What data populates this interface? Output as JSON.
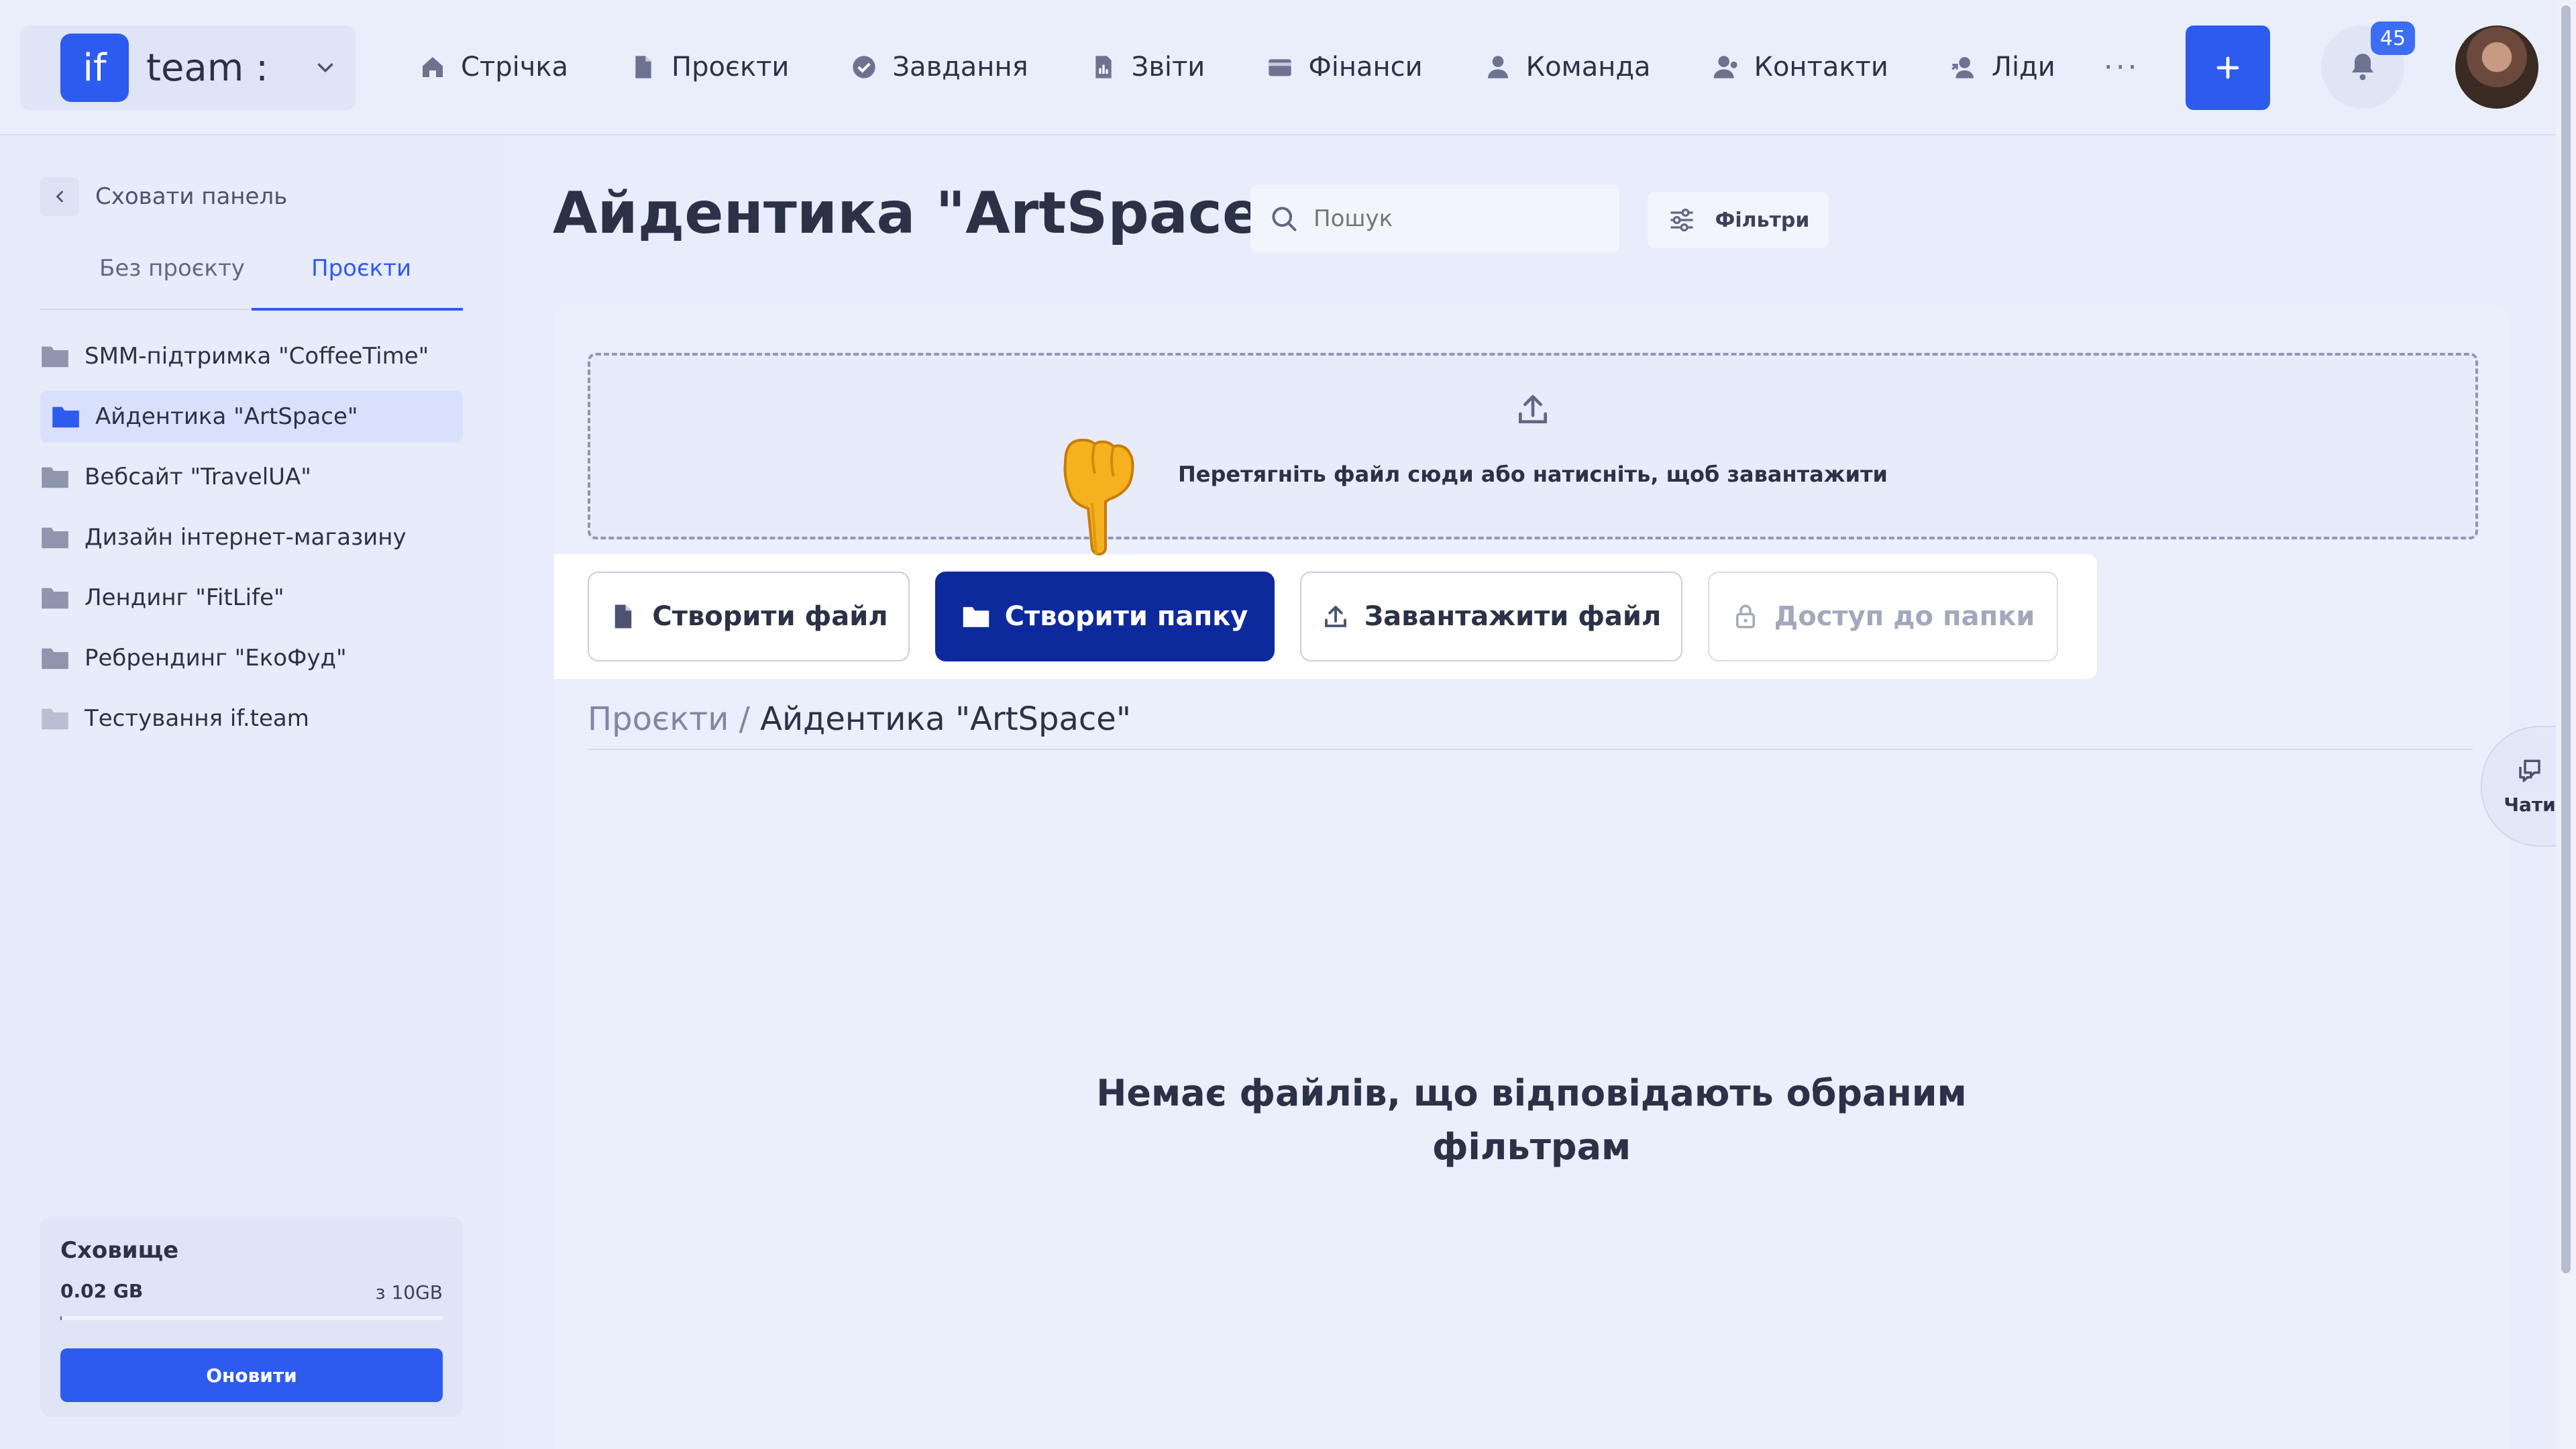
{
  "header": {
    "brand_logo": "if",
    "brand_name": "team :",
    "nav": [
      {
        "label": "Стрічка",
        "icon": "home-icon"
      },
      {
        "label": "Проєкти",
        "icon": "document-icon"
      },
      {
        "label": "Завдання",
        "icon": "check-circle-icon"
      },
      {
        "label": "Звіти",
        "icon": "report-icon"
      },
      {
        "label": "Фінанси",
        "icon": "wallet-icon"
      },
      {
        "label": "Команда",
        "icon": "user-icon"
      },
      {
        "label": "Контакти",
        "icon": "contacts-icon"
      },
      {
        "label": "Ліди",
        "icon": "leads-icon"
      }
    ],
    "more": "···",
    "notifications_count": "45"
  },
  "sidebar": {
    "hide_panel": "Сховати панель",
    "tabs": [
      {
        "label": "Без проєкту"
      },
      {
        "label": "Проєкти"
      }
    ],
    "projects": [
      {
        "label": "SMM-підтримка \"CoffeeTime\""
      },
      {
        "label": "Айдентика \"ArtSpace\""
      },
      {
        "label": "Вебсайт \"TravelUA\""
      },
      {
        "label": "Дизайн інтернет-магазину"
      },
      {
        "label": "Лендинг \"FitLife\""
      },
      {
        "label": "Ребрендинг \"ЕкоФуд\""
      },
      {
        "label": "Тестування if.team"
      }
    ],
    "storage": {
      "title": "Сховище",
      "used": "0.02 GB",
      "total": "з 10GB",
      "used_fraction": 0.002,
      "upgrade_label": "Оновити"
    }
  },
  "main": {
    "title": "Айдентика \"ArtSpace\"",
    "search_placeholder": "Пошук",
    "filters_label": "Фільтри",
    "dropzone_text": "Перетягніть файл сюди або натисніть, щоб завантажити",
    "actions": {
      "create_file": "Створити файл",
      "create_folder": "Створити папку",
      "upload_file": "Завантажити файл",
      "folder_access": "Доступ до папки"
    },
    "breadcrumb": {
      "root": "Проєкти /",
      "current": "Айдентика \"ArtSpace\""
    },
    "empty_line1": "Немає файлів, що відповідають обраним",
    "empty_line2": "фільтрам"
  },
  "chats": {
    "label": "Чати"
  },
  "colors": {
    "accent": "#2d5bf0",
    "primary_dark": "#0d2a9c",
    "background": "#e8ecfb"
  }
}
